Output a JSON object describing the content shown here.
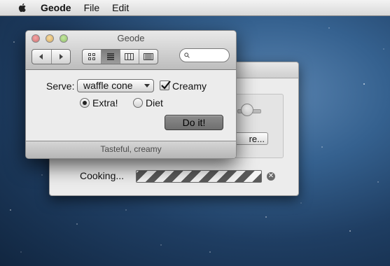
{
  "menubar": {
    "app_name": "Geode",
    "items": [
      "File",
      "Edit"
    ]
  },
  "back_window": {
    "button_label": "re...",
    "cooking_label": "Cooking...",
    "progress_indeterminate": true
  },
  "window": {
    "title": "Geode",
    "search": {
      "value": "",
      "placeholder": ""
    },
    "view_modes": [
      "icon-view",
      "list-view",
      "column-view",
      "coverflow-view"
    ],
    "selected_view": "list-view",
    "serve_label": "Serve:",
    "serve_selected": "waffle cone",
    "creamy_label": "Creamy",
    "creamy_checked": true,
    "radio_options": [
      {
        "label": "Extra!",
        "selected": true
      },
      {
        "label": "Diet",
        "selected": false
      }
    ],
    "action_button": "Do it!",
    "status_text": "Tasteful, creamy"
  }
}
